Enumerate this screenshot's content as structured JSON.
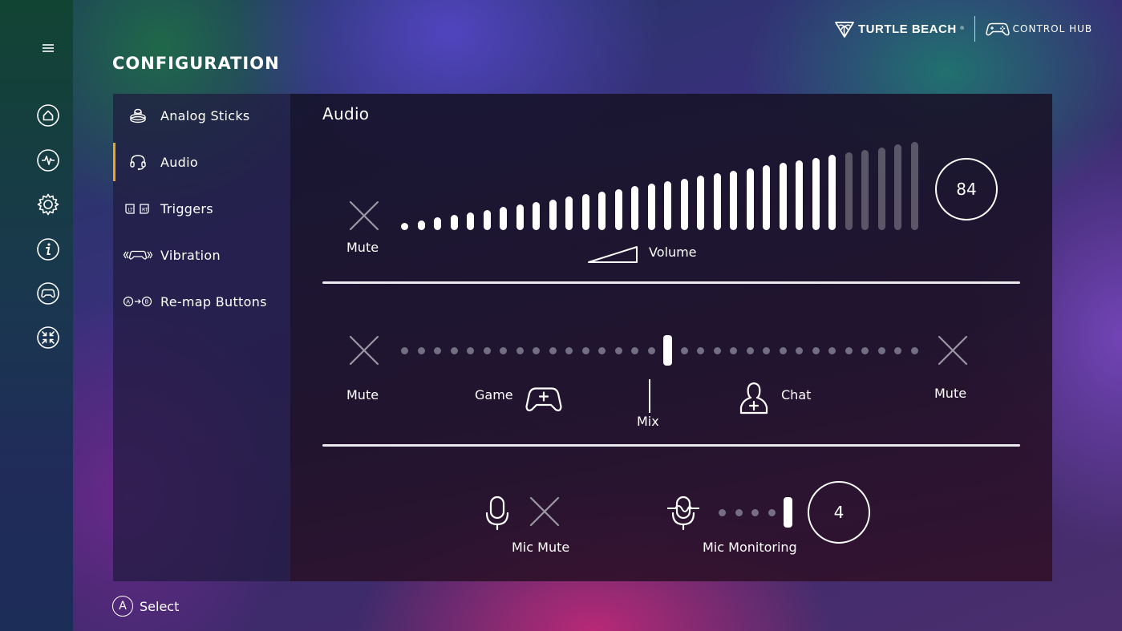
{
  "header": {
    "page_title": "CONFIGURATION",
    "brand_name": "TURTLE BEACH",
    "brand_trademark": "®",
    "hub_name": "CONTROL HUB"
  },
  "rail": {
    "items": [
      {
        "icon": "home-icon"
      },
      {
        "icon": "activity-icon"
      },
      {
        "icon": "gear-icon"
      },
      {
        "icon": "info-icon"
      },
      {
        "icon": "controller-icon"
      },
      {
        "icon": "collapse-icon"
      }
    ]
  },
  "nav": {
    "items": [
      {
        "label": "Analog Sticks",
        "icon": "analog-stick-icon"
      },
      {
        "label": "Audio",
        "icon": "headset-icon",
        "active": true
      },
      {
        "label": "Triggers",
        "icon": "triggers-icon"
      },
      {
        "label": "Vibration",
        "icon": "vibration-icon"
      },
      {
        "label": "Re-map Buttons",
        "icon": "remap-icon"
      }
    ],
    "accent": "#f3a21c"
  },
  "audio": {
    "title": "Audio",
    "volume": {
      "mute_label": "Mute",
      "label": "Volume",
      "value": "84",
      "total_steps": 32,
      "filled_steps": 27
    },
    "mix": {
      "left_mute_label": "Mute",
      "right_mute_label": "Mute",
      "game_label": "Game",
      "mix_label": "Mix",
      "chat_label": "Chat",
      "total_positions": 32,
      "position": 16
    },
    "mic": {
      "mic_mute_label": "Mic Mute",
      "monitoring_label": "Mic Monitoring",
      "monitoring_value": "4",
      "monitoring_steps": 5
    }
  },
  "footer": {
    "button_glyph": "A",
    "select_label": "Select"
  }
}
